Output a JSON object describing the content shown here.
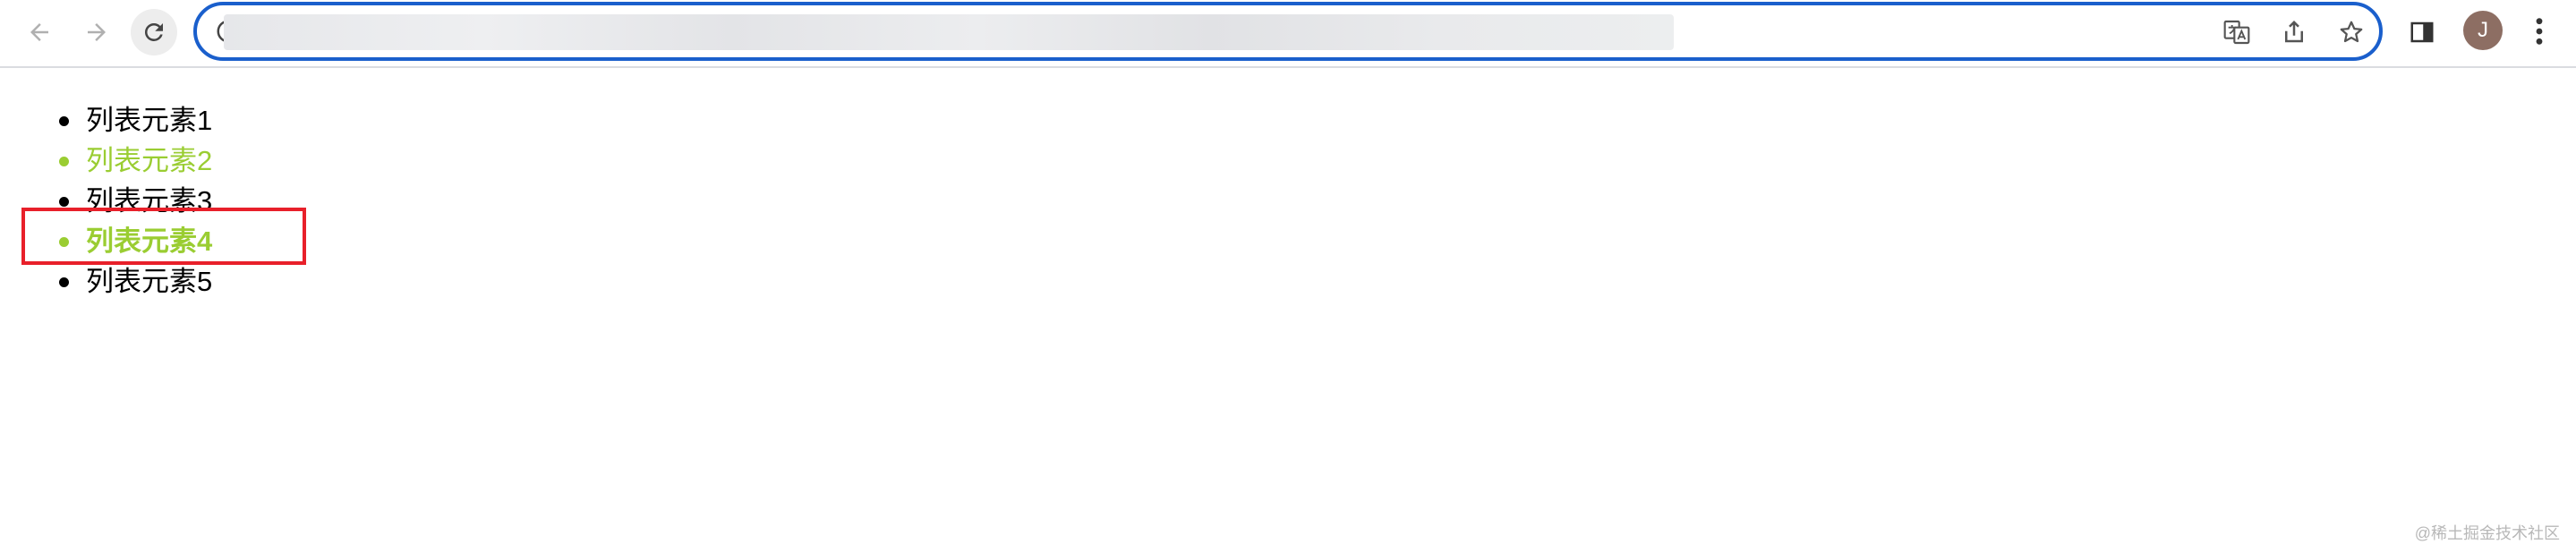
{
  "browser": {
    "avatar_letter": "J",
    "accent_color": "#1a5fcc",
    "avatar_color": "#8d6e63",
    "icons": [
      "back-arrow-icon",
      "forward-arrow-icon",
      "reload-icon",
      "site-info-icon",
      "translate-icon",
      "share-icon",
      "star-icon",
      "side-panel-icon",
      "more-vert-icon"
    ]
  },
  "list": {
    "items": [
      {
        "label": "列表元素1"
      },
      {
        "label": "列表元素2"
      },
      {
        "label": "列表元素3"
      },
      {
        "label": "列表元素4"
      },
      {
        "label": "列表元素5"
      }
    ],
    "accent_color": "#9acd32",
    "highlight_color": "#e8202a"
  },
  "watermark": "@稀土掘金技术社区"
}
